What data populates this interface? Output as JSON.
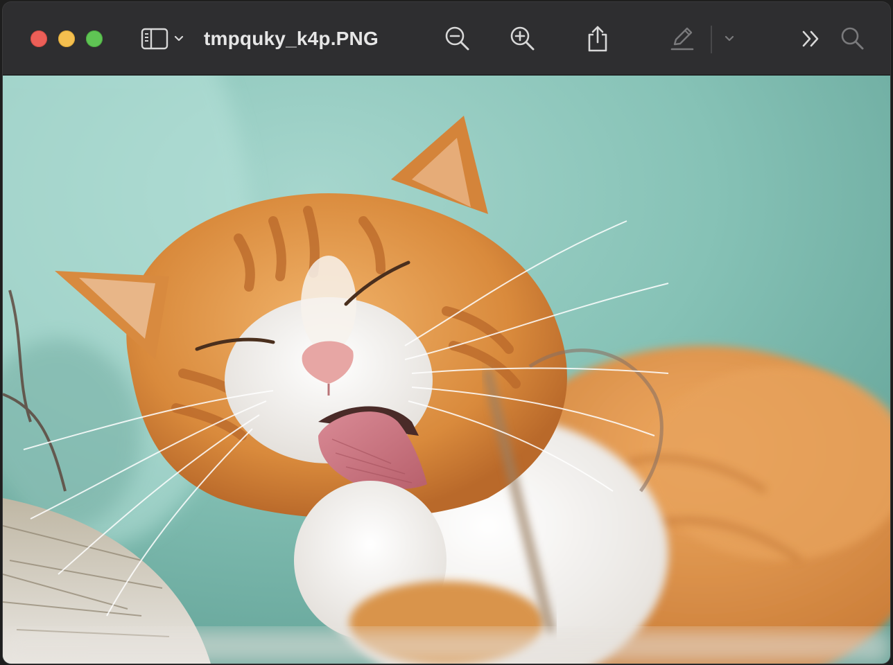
{
  "window": {
    "title": "tmpquky_k4p.PNG"
  },
  "toolbar": {
    "sidebar_toggle": {
      "icon": "sidebar-icon",
      "chevron": "chevron-down-icon"
    },
    "zoom_out": {
      "icon": "zoom-out-icon"
    },
    "zoom_in": {
      "icon": "zoom-in-icon"
    },
    "share": {
      "icon": "share-icon"
    },
    "markup": {
      "icon": "pencil-icon",
      "chevron": "chevron-down-icon",
      "state": "disabled"
    },
    "more": {
      "icon": "double-chevron-right-icon"
    },
    "search": {
      "icon": "search-icon",
      "state": "disabled"
    }
  },
  "traffic_lights": {
    "close": "#ec5f58",
    "minimize": "#f4bf4f",
    "zoom": "#5fc454"
  },
  "colors": {
    "titlebar_bg": "#2e2e30",
    "icon_active": "#d8d8d8",
    "icon_disabled": "#7a7a7c",
    "title_text": "#e6e6e6"
  },
  "image": {
    "subject": "orange-and-white-cat-licking-paw"
  }
}
